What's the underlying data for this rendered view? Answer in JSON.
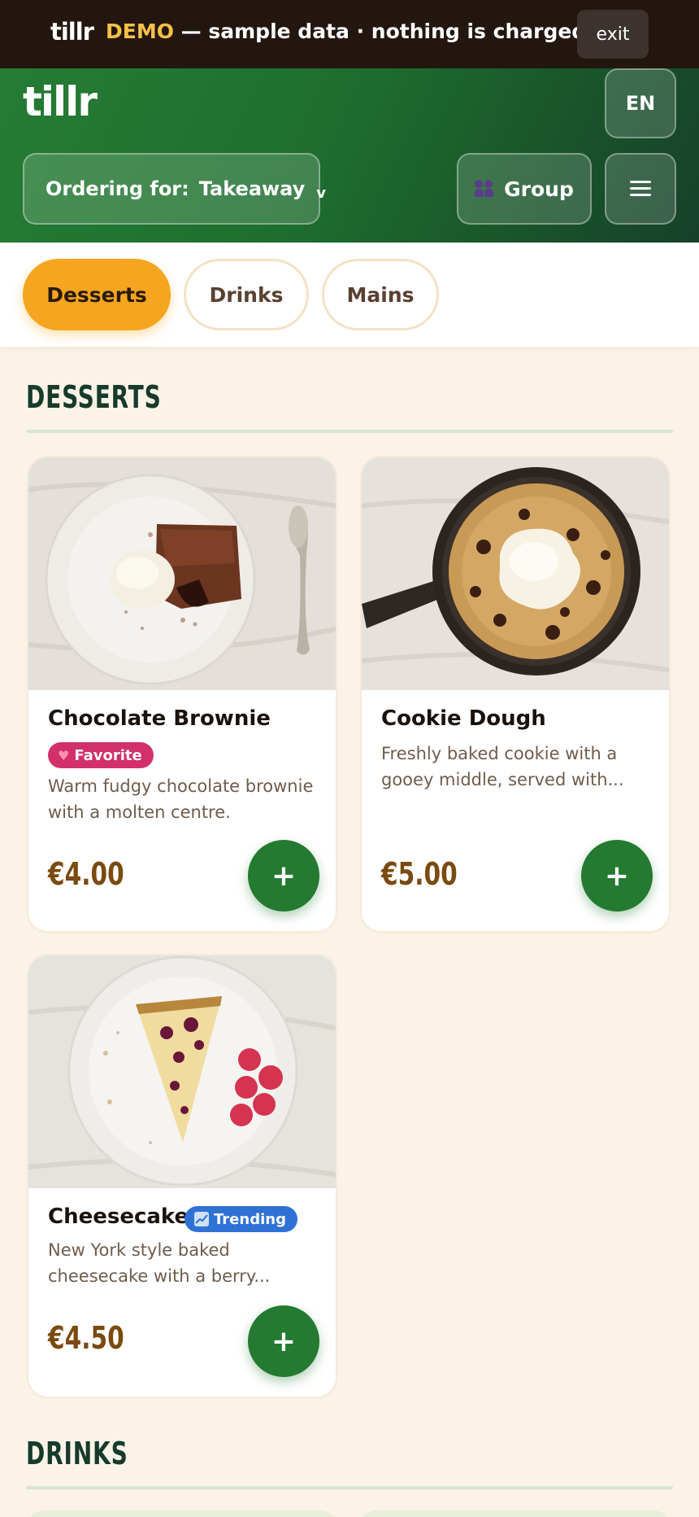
{
  "demo_banner": {
    "logo": "tillr",
    "demo_word": "DEMO",
    "message": " — sample data · nothing is charged",
    "exit_label": "exit"
  },
  "header": {
    "brand": "tillr",
    "language": "EN",
    "ordering_label": "Ordering for:",
    "ordering_value": "Takeaway",
    "ordering_chevron": "v",
    "group_label": "Group",
    "group_icon": "people-icon",
    "menu_icon": "hamburger-menu-icon"
  },
  "tabs": [
    {
      "label": "Desserts",
      "active": true
    },
    {
      "label": "Drinks",
      "active": false
    },
    {
      "label": "Mains",
      "active": false
    }
  ],
  "sections": [
    {
      "title": "DESSERTS",
      "items": [
        {
          "name": "Chocolate Brownie",
          "badge": "Favorite",
          "badge_icon": "heart-icon",
          "description": "Warm fudgy chocolate brownie with a molten centre.",
          "price": "€4.00"
        },
        {
          "name": "Cookie Dough",
          "badge": "",
          "description": "Freshly baked cookie with a gooey middle, served with...",
          "price": "€5.00"
        },
        {
          "name": "Cheesecake",
          "badge": "Trending",
          "badge_icon": "chart-up-icon",
          "description": "New York style baked cheesecake with a berry...",
          "price": "€4.50"
        }
      ]
    },
    {
      "title": "DRINKS",
      "items": []
    }
  ],
  "add_label": "+",
  "colors": {
    "primary_green": "#237a30",
    "accent_orange": "#f6a520",
    "price_brown": "#7a4a10",
    "favorite_pink": "#d2306a",
    "trending_blue": "#2f72d6"
  }
}
